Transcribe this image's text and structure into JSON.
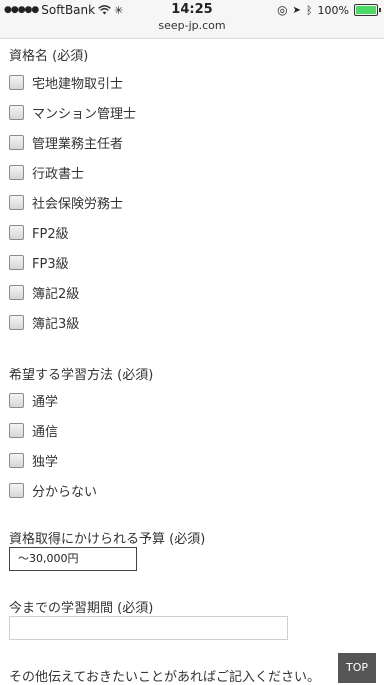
{
  "status_bar": {
    "carrier": "SoftBank",
    "time": "14:25",
    "url": "seep-jp.com",
    "battery": "100%",
    "battery_level": 1.0,
    "signal_dots": "●●●●●"
  },
  "form": {
    "qualification": {
      "title": "資格名 (必須)",
      "options": [
        "宅地建物取引士",
        "マンション管理士",
        "管理業務主任者",
        "行政書士",
        "社会保険労務士",
        "FP2級",
        "FP3級",
        "簿記2級",
        "簿記3級"
      ]
    },
    "study_method": {
      "title": "希望する学習方法 (必須)",
      "options": [
        "通学",
        "通信",
        "独学",
        "分からない"
      ]
    },
    "budget": {
      "title": "資格取得にかけられる予算 (必須)",
      "selected": "〜30,000円"
    },
    "study_period": {
      "title": "今までの学習期間 (必須)",
      "value": ""
    },
    "other": {
      "title": "その他伝えておきたいことがあればご記入ください。"
    }
  },
  "top_button": {
    "label": "TOP"
  }
}
